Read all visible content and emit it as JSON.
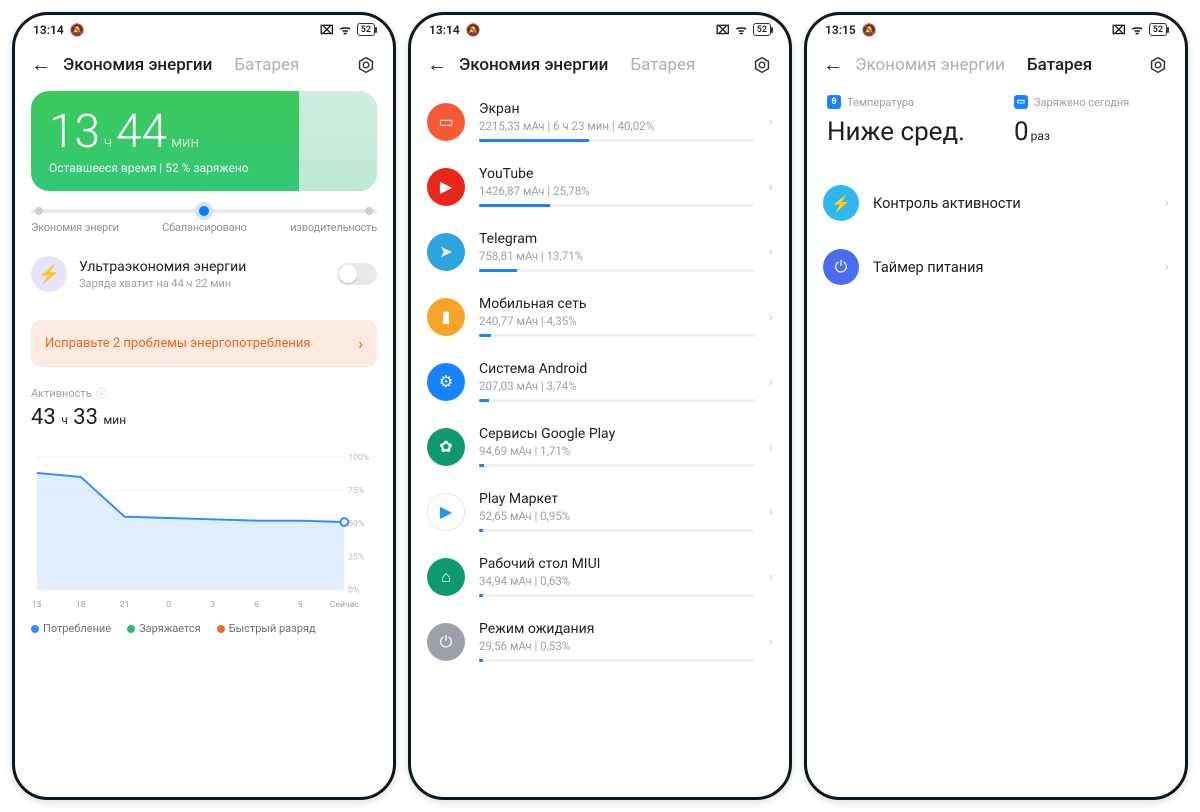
{
  "statusbar": {
    "time1": "13:14",
    "time2": "13:14",
    "time3": "13:15",
    "battery": "52"
  },
  "tabs": {
    "energy": "Экономия энергии",
    "battery": "Батарея"
  },
  "phone1": {
    "hero": {
      "h": "13",
      "h_unit": "ч",
      "m": "44",
      "m_unit": "мин",
      "sub": "Оставшееся время | 52 % заряжено"
    },
    "slider_labels": {
      "l": "Экономия энерги",
      "c": "Сбалансировано",
      "r": "изводительность"
    },
    "ultra": {
      "title": "Ультраэкономия энергии",
      "sub": "Заряда хватит на 44 ч 22 мин"
    },
    "warning": "Исправьте 2 проблемы энергопотребления",
    "activity": {
      "label": "Активность",
      "h": "43",
      "h_u": "ч",
      "m": "33",
      "m_u": "мин"
    },
    "legend": {
      "consume": "Потребление",
      "charge": "Заряжается",
      "fast": "Быстрый разряд"
    }
  },
  "phone2": {
    "apps": [
      {
        "name": "Экран",
        "sub": "2215,33 мАч | 6 ч 23 мин  | 40,02%",
        "pct": 40,
        "bg": "#f45a35",
        "icon": "▭"
      },
      {
        "name": "YouTube",
        "sub": "1426,87 мАч | 25,78%",
        "pct": 25.8,
        "bg": "#e8261a",
        "icon": "▶"
      },
      {
        "name": "Telegram",
        "sub": "758,81 мАч | 13,71%",
        "pct": 13.7,
        "bg": "#2da3e0",
        "icon": "➤"
      },
      {
        "name": "Мобильная сеть",
        "sub": "240,77 мАч | 4,35%",
        "pct": 4.4,
        "bg": "#f7a428",
        "icon": "▮"
      },
      {
        "name": "Система Android",
        "sub": "207,03 мАч | 3,74%",
        "pct": 3.7,
        "bg": "#1783ff",
        "icon": "⚙"
      },
      {
        "name": "Сервисы Google Play",
        "sub": "94,69 мАч | 1,71%",
        "pct": 1.7,
        "bg": "#0e9970",
        "icon": "✿"
      },
      {
        "name": "Play Маркет",
        "sub": "52,65 мАч | 0,95%",
        "pct": 1.0,
        "bg": "#ffffff",
        "icon": "▶",
        "fg": "#2196f3",
        "border": "#e0e4e8"
      },
      {
        "name": "Рабочий стол MIUI",
        "sub": "34,94 мАч | 0,63%",
        "pct": 0.6,
        "bg": "#0e9970",
        "icon": "⌂"
      },
      {
        "name": "Режим ожидания",
        "sub": "29,56 мАч | 0,53%",
        "pct": 0.5,
        "bg": "#9aa1a8",
        "icon": "⏻"
      }
    ]
  },
  "phone3": {
    "tile1": {
      "label": "Температура",
      "value": "Ниже сред."
    },
    "tile2": {
      "label": "Заряжено сегодня",
      "value": "0",
      "unit": "раз"
    },
    "rows": [
      {
        "name": "Контроль активности",
        "bg": "#2fb8f0",
        "icon": "⚡"
      },
      {
        "name": "Таймер питания",
        "bg": "#4c6cf0",
        "icon": "⏻"
      }
    ]
  },
  "chart_data": {
    "type": "area",
    "xlabels": [
      "15",
      "18",
      "21",
      "0",
      "3",
      "6",
      "9",
      "Сейчас"
    ],
    "x": [
      15,
      18,
      21,
      24,
      27,
      30,
      33,
      36
    ],
    "y": [
      88,
      85,
      55,
      54,
      53,
      52,
      52,
      51
    ],
    "ylim": [
      0,
      100
    ],
    "yticks": [
      0,
      25,
      50,
      75,
      100
    ],
    "title": "Активность",
    "series_name": "Потребление"
  }
}
